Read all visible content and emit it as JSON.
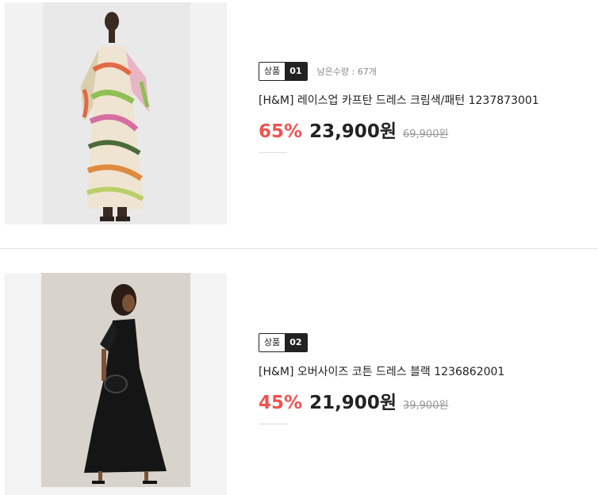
{
  "products": [
    {
      "tag_label": "상품",
      "tag_number": "01",
      "stock_text": "남은수량 : 67개",
      "name": "[H&M] 레이스업 카프탄 드레스 크림색/패턴 1237873001",
      "discount_rate": "65%",
      "sale_price": "23,900원",
      "original_price": "69,900원"
    },
    {
      "tag_label": "상품",
      "tag_number": "02",
      "name": "[H&M] 오버사이즈 코튼 드레스 블랙 1236862001",
      "discount_rate": "45%",
      "sale_price": "21,900원",
      "original_price": "39,900원"
    }
  ],
  "colors": {
    "discount": "#ef5350",
    "tag_dark": "#222222",
    "text": "#222222",
    "muted": "#999999"
  }
}
